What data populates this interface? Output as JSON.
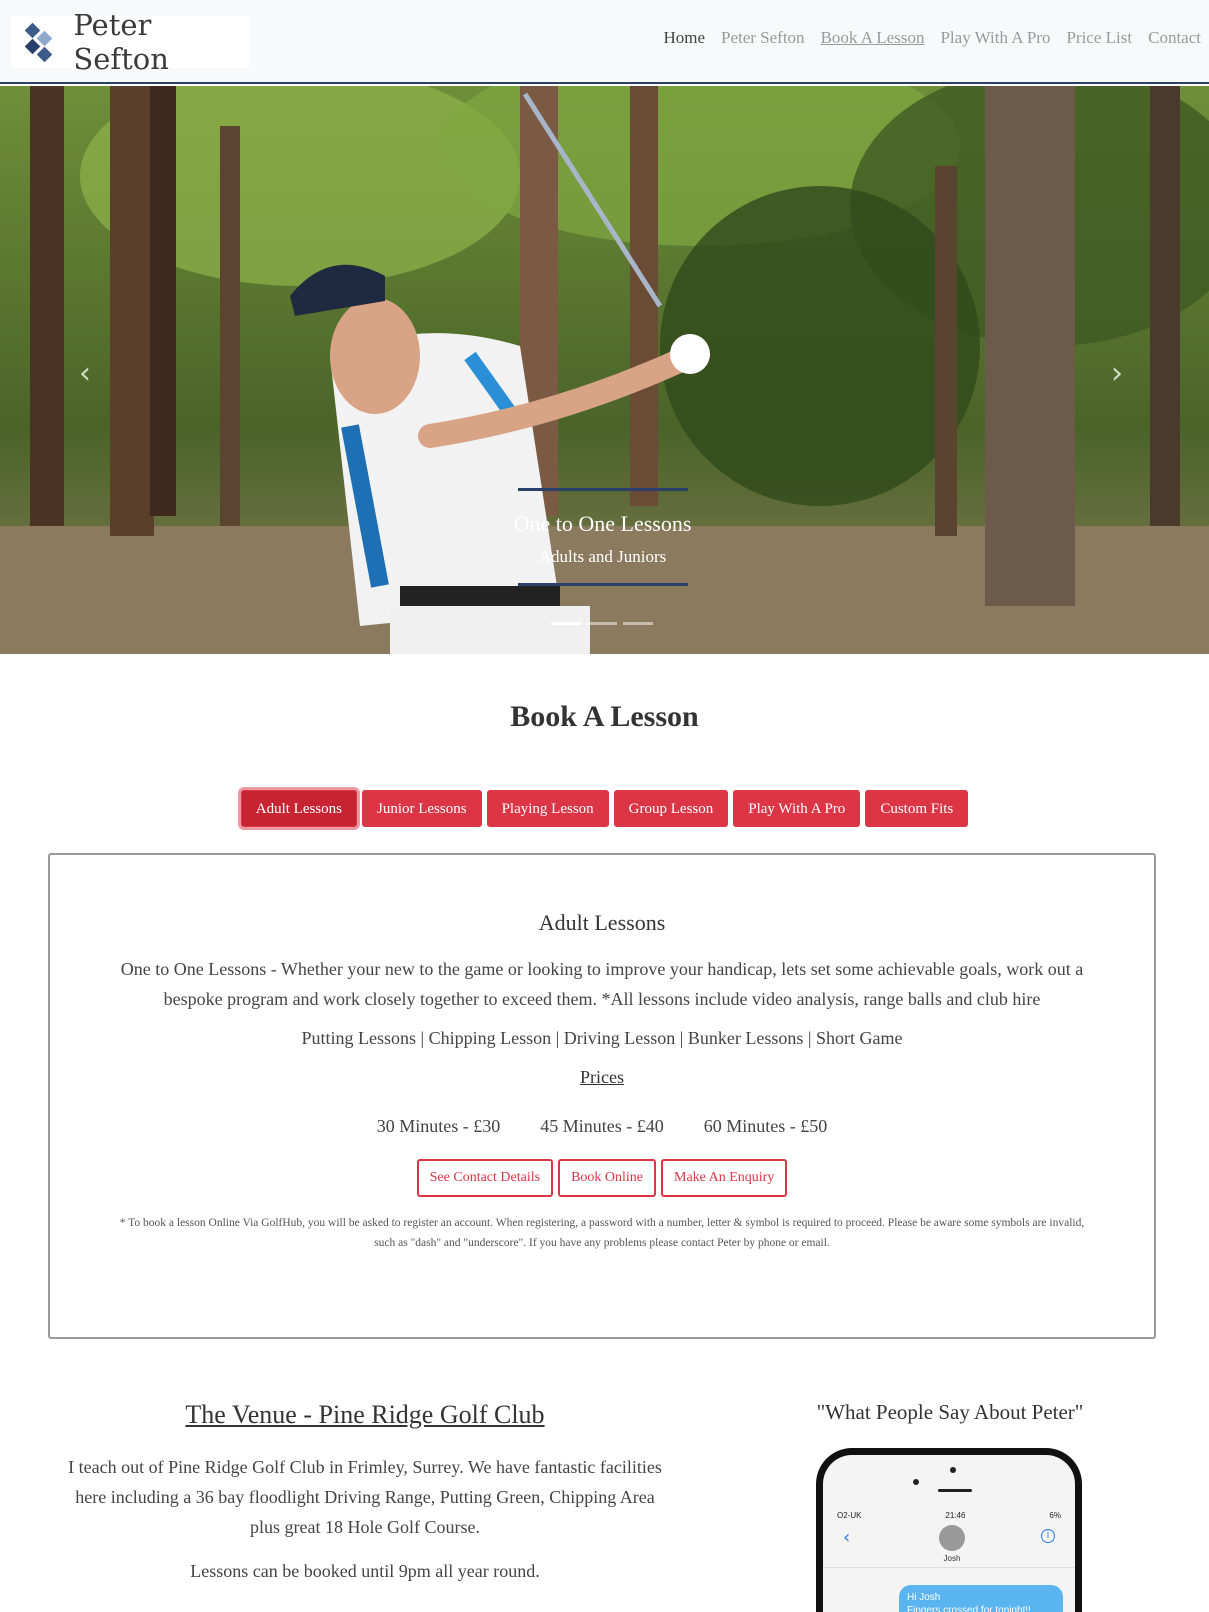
{
  "brand": {
    "name": "Peter Sefton",
    "logo_icon": "diamond-logo-icon"
  },
  "nav": {
    "items": [
      {
        "label": "Home"
      },
      {
        "label": "Peter Sefton"
      },
      {
        "label": "Book A Lesson"
      },
      {
        "label": "Play With A Pro"
      },
      {
        "label": "Price List"
      },
      {
        "label": "Contact"
      }
    ],
    "active": "Book A Lesson"
  },
  "carousel": {
    "caption_title": "One to One Lessons",
    "caption_subtitle": "Adults and Juniors",
    "slides": 3,
    "active_slide": 1,
    "prev_icon": "chevron-left-icon",
    "next_icon": "chevron-right-icon"
  },
  "section": {
    "title": "Book A Lesson"
  },
  "tabs": [
    {
      "label": "Adult Lessons",
      "active": true
    },
    {
      "label": "Junior Lessons"
    },
    {
      "label": "Playing Lesson"
    },
    {
      "label": "Group Lesson"
    },
    {
      "label": "Play With A Pro"
    },
    {
      "label": "Custom Fits"
    }
  ],
  "panel": {
    "title": "Adult Lessons",
    "description": "One to One Lessons - Whether your new to the game or looking to improve your handicap, lets set some achievable goals, work out a bespoke program and work closely together to exceed them. *All lessons include video analysis, range balls and club hire",
    "types": "Putting Lessons | Chipping Lesson | Driving Lesson | Bunker Lessons | Short Game",
    "prices_label": "Prices",
    "prices": [
      "30 Minutes - £30",
      "45 Minutes - £40",
      "60 Minutes - £50"
    ],
    "buttons": {
      "contact": "See Contact Details",
      "book": "Book Online",
      "enquiry": "Make An Enquiry"
    },
    "note": "* To book a lesson Online Via GolfHub, you will be asked to register an account. When registering, a password with a number, letter & symbol is required to proceed. Please be aware some symbols are invalid, such as \"dash\" and \"underscore\". If you have any problems please contact Peter by phone or email."
  },
  "venue": {
    "title": "The Venue - Pine Ridge Golf Club",
    "p1": "I teach out of Pine Ridge Golf Club in Frimley, Surrey. We have fantastic facilities here including a 36 bay floodlight Driving Range, Putting Green, Chipping Area plus great 18 Hole Golf Course.",
    "p2": "Lessons can be booked until 9pm all year round."
  },
  "reviews": {
    "title": "\"What People Say About Peter\"",
    "phone": {
      "carrier": "O2-UK",
      "time": "21:46",
      "battery": "6%",
      "contact": "Josh",
      "message_line1": "Hi Josh",
      "message_line2": "Fingers crossed for tonight!!"
    }
  },
  "colors": {
    "accent": "#dc3545",
    "navy": "#2b3f6b"
  }
}
